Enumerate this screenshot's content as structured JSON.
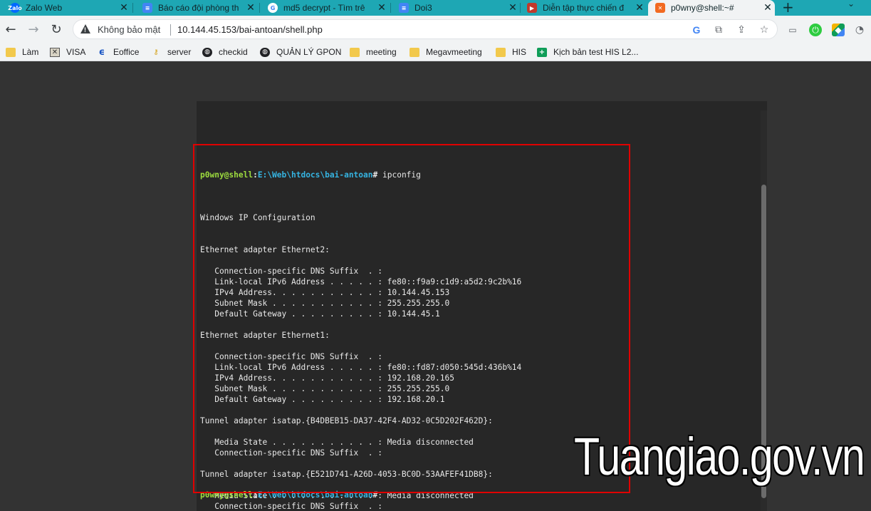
{
  "tabs": [
    {
      "title": "Zalo Web",
      "icon": "zalo-icon",
      "icon_text": "Zalo",
      "color": "#0068ff"
    },
    {
      "title": "Báo cáo đội phòng th",
      "icon": "document-icon",
      "icon_text": "≡",
      "color": "#4285f4"
    },
    {
      "title": "md5 decrypt - Tìm trê",
      "icon": "google-icon",
      "icon_text": "G",
      "color": "#ffffff"
    },
    {
      "title": "Doi3",
      "icon": "document-icon",
      "icon_text": "≡",
      "color": "#4285f4"
    },
    {
      "title": "Diễn tập thực chiến đ",
      "icon": "video-icon",
      "icon_text": "▶",
      "color": "#c0392b"
    },
    {
      "title": "p0wny@shell:~#",
      "icon": "xampp-icon",
      "icon_text": "✕",
      "color": "#f26a21"
    }
  ],
  "toolbar": {
    "security_label": "Không bảo mật",
    "url": "10.144.45.153/bai-antoan/shell.php"
  },
  "bookmarks": [
    {
      "label": "Làm",
      "icon": "folder-icon"
    },
    {
      "label": "VISA",
      "icon": "visa-icon"
    },
    {
      "label": "Eoffice",
      "icon": "eoffice-icon"
    },
    {
      "label": "server",
      "icon": "key-icon"
    },
    {
      "label": "checkid",
      "icon": "globe-icon"
    },
    {
      "label": "QUẢN LÝ GPON",
      "icon": "globe-icon"
    },
    {
      "label": "meeting",
      "icon": "folder-icon"
    },
    {
      "label": "Megavmeeting",
      "icon": "folder-icon"
    },
    {
      "label": "HIS",
      "icon": "folder-icon"
    },
    {
      "label": "Kịch bản test HIS L2...",
      "icon": "sheets-icon"
    }
  ],
  "terminal": {
    "prompt_user": "p0wny@shell",
    "prompt_sep": ":",
    "prompt_path": "E:\\Web\\htdocs\\bai-antoan",
    "prompt_hash": "#",
    "command": "ipconfig",
    "lines": [
      "",
      "Windows IP Configuration",
      "",
      "",
      "Ethernet adapter Ethernet2:",
      "",
      "   Connection-specific DNS Suffix  . :",
      "   Link-local IPv6 Address . . . . . : fe80::f9a9:c1d9:a5d2:9c2b%16",
      "   IPv4 Address. . . . . . . . . . . : 10.144.45.153",
      "   Subnet Mask . . . . . . . . . . . : 255.255.255.0",
      "   Default Gateway . . . . . . . . . : 10.144.45.1",
      "",
      "Ethernet adapter Ethernet1:",
      "",
      "   Connection-specific DNS Suffix  . :",
      "   Link-local IPv6 Address . . . . . : fe80::fd87:d050:545d:436b%14",
      "   IPv4 Address. . . . . . . . . . . : 192.168.20.165",
      "   Subnet Mask . . . . . . . . . . . : 255.255.255.0",
      "   Default Gateway . . . . . . . . . : 192.168.20.1",
      "",
      "Tunnel adapter isatap.{B4DBEB15-DA37-42F4-AD32-0C5D202F462D}:",
      "",
      "   Media State . . . . . . . . . . . : Media disconnected",
      "   Connection-specific DNS Suffix  . :",
      "",
      "Tunnel adapter isatap.{E521D741-A26D-4053-BC0D-53AAFEF41DB8}:",
      "",
      "   Media State . . . . . . . . . . . : Media disconnected",
      "   Connection-specific DNS Suffix  . :"
    ]
  },
  "watermark": "Tuangiao.gov.vn",
  "colors": {
    "tabstrip": "#1ea7b4",
    "terminal_bg": "#272727",
    "prompt_user": "#9ddb3e",
    "prompt_path": "#35b3e0",
    "highlight_box": "#e00000"
  }
}
